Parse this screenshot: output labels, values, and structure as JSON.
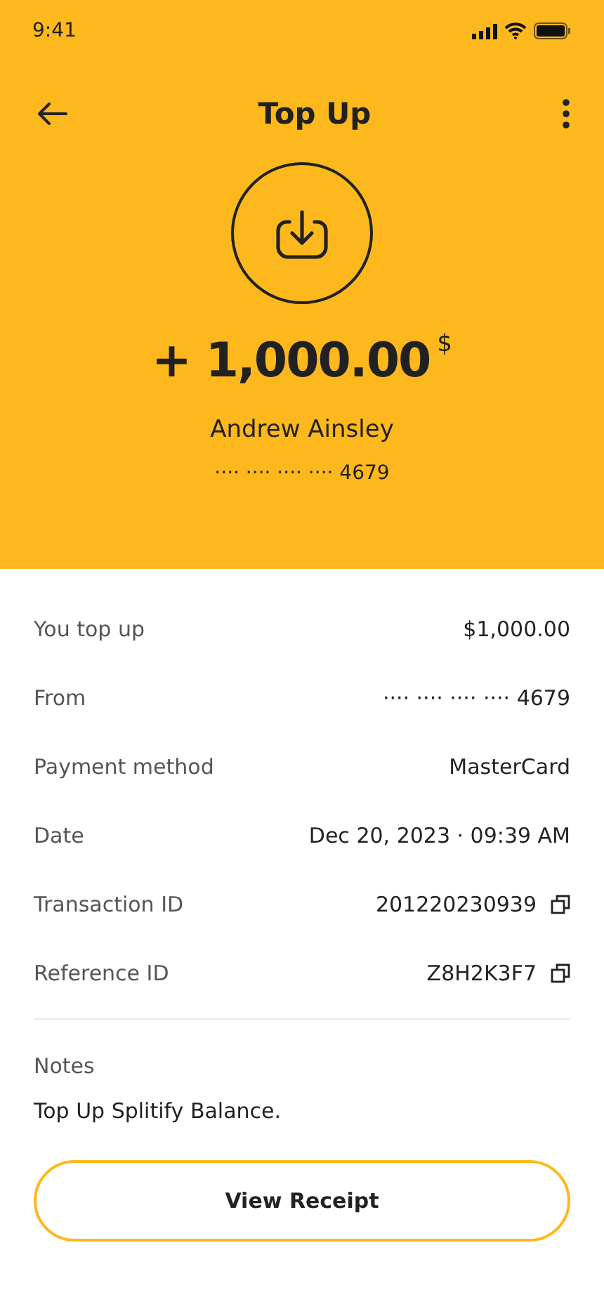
{
  "status_bar": {
    "time": "9:41"
  },
  "header": {
    "title": "Top Up"
  },
  "summary": {
    "amount": "+ 1,000.00",
    "currency": "$",
    "name": "Andrew Ainsley",
    "card": "···· ···· ···· ···· 4679"
  },
  "details": [
    {
      "label": "You top up",
      "value": "$1,000.00",
      "copyable": false
    },
    {
      "label": "From",
      "value": "···· ···· ···· ···· 4679",
      "copyable": false
    },
    {
      "label": "Payment method",
      "value": "MasterCard",
      "copyable": false
    },
    {
      "label": "Date",
      "value": "Dec 20, 2023 · 09:39 AM",
      "copyable": false
    },
    {
      "label": "Transaction ID",
      "value": "201220230939",
      "copyable": true
    },
    {
      "label": "Reference ID",
      "value": "Z8H2K3F7",
      "copyable": true
    }
  ],
  "notes": {
    "label": "Notes",
    "text": "Top Up Splitify Balance."
  },
  "button": "View Receipt"
}
